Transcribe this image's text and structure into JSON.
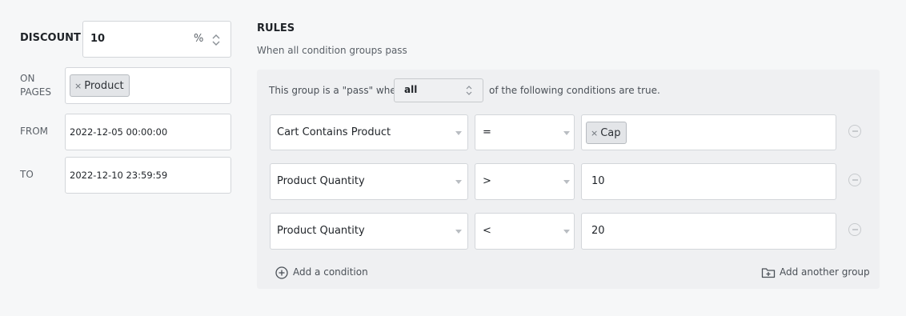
{
  "discount": {
    "label": "DISCOUNT",
    "value": "10",
    "unit": "%"
  },
  "on_pages": {
    "label": "ON PAGES",
    "tags": [
      "Product"
    ]
  },
  "from": {
    "label": "FROM",
    "value": "2022-12-05 00:00:00"
  },
  "to": {
    "label": "TO",
    "value": "2022-12-10 23:59:59"
  },
  "rules": {
    "title": "RULES",
    "subtitle": "When all condition groups pass",
    "group": {
      "prefix": "This group is a \"pass\" when",
      "mode": "all",
      "suffix": "of the following conditions are true.",
      "conditions": [
        {
          "field": "Cart Contains Product",
          "operator": "=",
          "tag": "Cap"
        },
        {
          "field": "Product Quantity",
          "operator": ">",
          "value": "10"
        },
        {
          "field": "Product Quantity",
          "operator": "<",
          "value": "20"
        }
      ],
      "add_condition": "Add a condition",
      "add_group": "Add another group"
    }
  },
  "icons": {
    "remove": "minus-circle-icon",
    "add_condition": "plus-circle-icon",
    "add_group": "folder-plus-icon",
    "spinner": "stepper-arrows-icon",
    "dropdown": "caret-down-icon"
  }
}
